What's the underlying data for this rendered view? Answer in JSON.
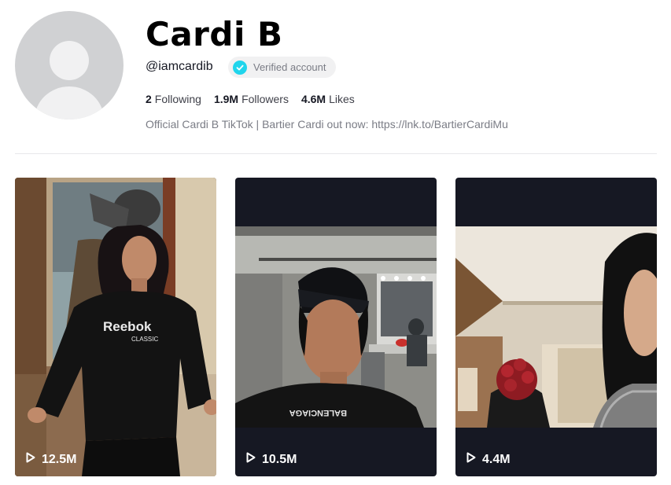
{
  "profile": {
    "name": "Cardi B",
    "handle": "@iamcardib",
    "verified_label": "Verified account",
    "stats": [
      {
        "count": "2",
        "label": "Following"
      },
      {
        "count": "1.9M",
        "label": "Followers"
      },
      {
        "count": "4.6M",
        "label": "Likes"
      }
    ],
    "bio": "Official Cardi B TikTok | Bartier Cardi out now: https://lnk.to/BartierCardiMu"
  },
  "videos": [
    {
      "views": "12.5M",
      "reebok_text": "Reebok",
      "classic_text": "CLASSIC"
    },
    {
      "views": "10.5M",
      "shirt_text": "BALENCIAGA"
    },
    {
      "views": "4.4M"
    }
  ],
  "colors": {
    "verified_badge": "#20d5ec",
    "tile_background": "#161823",
    "avatar_placeholder": "#d0d1d3"
  }
}
